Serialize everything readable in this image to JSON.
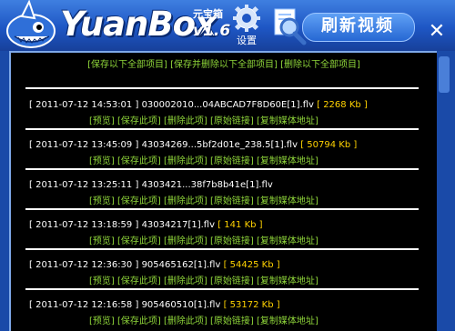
{
  "app": {
    "brand": "YuanBox",
    "brand_sub": "元宝箱",
    "version": "v1.6",
    "settings_label": "设置",
    "refresh_label": "刷新视频",
    "close_glyph": "✕"
  },
  "top_actions": [
    "[保存以下全部项目]",
    "[保存并删除以下全部项目]",
    "[删除以下全部项目]"
  ],
  "entries": [
    {
      "time": "[ 2011-07-12 14:53:01 ]",
      "file": "030002010...04ABCAD7F8D60E[1].flv",
      "size": "[ 2268 Kb ]"
    },
    {
      "time": "[ 2011-07-12 13:45:09 ]",
      "file": "43034269...5bf2d01e_238.5[1].flv",
      "size": "[ 50794 Kb ]"
    },
    {
      "time": "[ 2011-07-12 13:25:11 ]",
      "file": "4303421...38f7b8b41e[1].flv",
      "size": ""
    },
    {
      "time": "[ 2011-07-12 13:18:59 ]",
      "file": "43034217[1].flv",
      "size": "[ 141 Kb ]"
    },
    {
      "time": "[ 2011-07-12 12:36:30 ]",
      "file": "905465162[1].flv",
      "size": "[ 54425 Kb ]"
    },
    {
      "time": "[ 2011-07-12 12:16:58 ]",
      "file": "905460510[1].flv",
      "size": "[ 53172 Kb ]"
    }
  ],
  "entry_actions": [
    "[预览]",
    "[保存此项]",
    "[删除此项]",
    "[原始链接]",
    "[复制媒体地址]"
  ],
  "icons": [
    "mascot-shark-icon",
    "gear-icon",
    "magnifier-icon",
    "close-icon"
  ],
  "colors": {
    "titlebar": "#1e56c4",
    "action_green": "#8fd63a",
    "size_yellow": "#ffd200",
    "panel_bg": "#000000"
  }
}
